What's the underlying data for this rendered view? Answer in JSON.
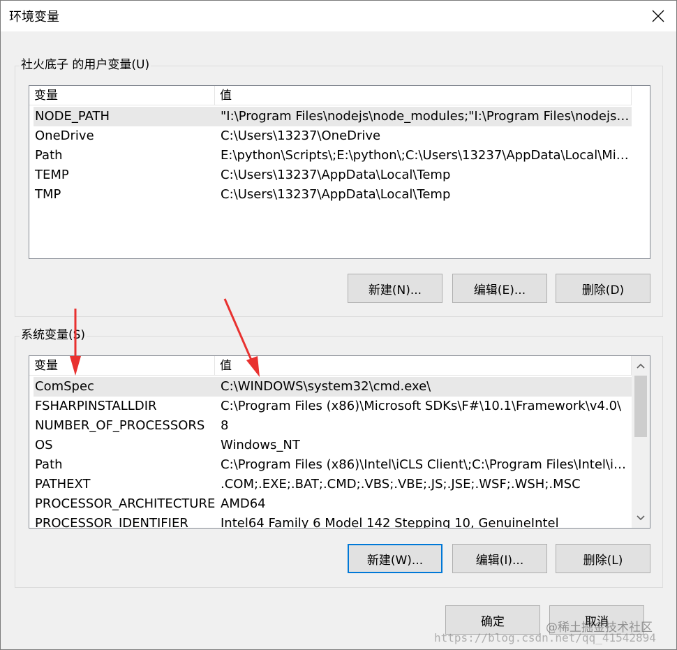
{
  "window": {
    "title": "环境变量"
  },
  "user_vars": {
    "group_label": "社火底子 的用户变量(U)",
    "columns": [
      "变量",
      "值"
    ],
    "rows": [
      {
        "name": "NODE_PATH",
        "value": "\"I:\\Program Files\\nodejs\\node_modules;\"I:\\Program Files\\nodejs\\n..."
      },
      {
        "name": "OneDrive",
        "value": "C:\\Users\\13237\\OneDrive"
      },
      {
        "name": "Path",
        "value": "E:\\python\\Scripts\\;E:\\python\\;C:\\Users\\13237\\AppData\\Local\\Micr..."
      },
      {
        "name": "TEMP",
        "value": "C:\\Users\\13237\\AppData\\Local\\Temp"
      },
      {
        "name": "TMP",
        "value": "C:\\Users\\13237\\AppData\\Local\\Temp"
      }
    ],
    "buttons": {
      "new": "新建(N)...",
      "edit": "编辑(E)...",
      "delete": "删除(D)"
    }
  },
  "system_vars": {
    "group_label": "系统变量(S)",
    "columns": [
      "变量",
      "值"
    ],
    "rows": [
      {
        "name": "ComSpec",
        "value": "C:\\WINDOWS\\system32\\cmd.exe\\"
      },
      {
        "name": "FSHARPINSTALLDIR",
        "value": "C:\\Program Files (x86)\\Microsoft SDKs\\F#\\10.1\\Framework\\v4.0\\"
      },
      {
        "name": "NUMBER_OF_PROCESSORS",
        "value": "8"
      },
      {
        "name": "OS",
        "value": "Windows_NT"
      },
      {
        "name": "Path",
        "value": "C:\\Program Files (x86)\\Intel\\iCLS Client\\;C:\\Program Files\\Intel\\iCL..."
      },
      {
        "name": "PATHEXT",
        "value": ".COM;.EXE;.BAT;.CMD;.VBS;.VBE;.JS;.JSE;.WSF;.WSH;.MSC"
      },
      {
        "name": "PROCESSOR_ARCHITECTURE",
        "value": "AMD64"
      },
      {
        "name": "PROCESSOR_IDENTIFIER",
        "value": "Intel64 Family 6 Model 142 Stepping 10, GenuineIntel"
      }
    ],
    "buttons": {
      "new": "新建(W)...",
      "edit": "编辑(I)...",
      "delete": "删除(L)"
    }
  },
  "footer": {
    "ok": "确定",
    "cancel": "取消"
  },
  "watermarks": {
    "juejin": "@稀土掘金技术社区",
    "csdn": "https://blog.csdn.net/qq_41542894"
  },
  "icons": {
    "close": "close-icon",
    "scroll_up": "chevron-up-icon",
    "scroll_down": "chevron-down-icon"
  },
  "colors": {
    "annotation_arrow": "#e8312f",
    "default_button_border": "#0078d7",
    "selected_row": "#e8e8e8"
  }
}
